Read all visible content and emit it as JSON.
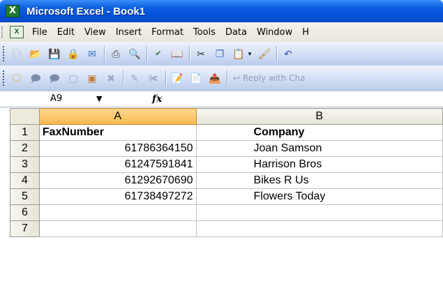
{
  "window": {
    "title": "Microsoft Excel - Book1",
    "app_icon": "excel-x-icon"
  },
  "menu": {
    "items": [
      {
        "label": "File"
      },
      {
        "label": "Edit"
      },
      {
        "label": "View"
      },
      {
        "label": "Insert"
      },
      {
        "label": "Format"
      },
      {
        "label": "Tools"
      },
      {
        "label": "Data"
      },
      {
        "label": "Window"
      },
      {
        "label": "H"
      }
    ]
  },
  "toolbar2": {
    "reply_label": "Reply with Cha"
  },
  "formula_bar": {
    "name_box": "A9",
    "fx_label": "fx",
    "formula": ""
  },
  "sheet": {
    "columns": [
      "A",
      "B"
    ],
    "selected_column": "A",
    "rows": [
      {
        "num": "1",
        "a": "FaxNumber",
        "b": "Company"
      },
      {
        "num": "2",
        "a": "61786364150",
        "b": "Joan Samson"
      },
      {
        "num": "3",
        "a": "61247591841",
        "b": "Harrison Bros"
      },
      {
        "num": "4",
        "a": "61292670690",
        "b": "Bikes R Us"
      },
      {
        "num": "5",
        "a": "61738497272",
        "b": "Flowers Today"
      },
      {
        "num": "6",
        "a": "",
        "b": ""
      },
      {
        "num": "7",
        "a": "",
        "b": ""
      }
    ]
  },
  "colors": {
    "titlebar": "#0550d8",
    "toolbar": "#cfdcf3",
    "selected_header": "#f8b84e"
  }
}
